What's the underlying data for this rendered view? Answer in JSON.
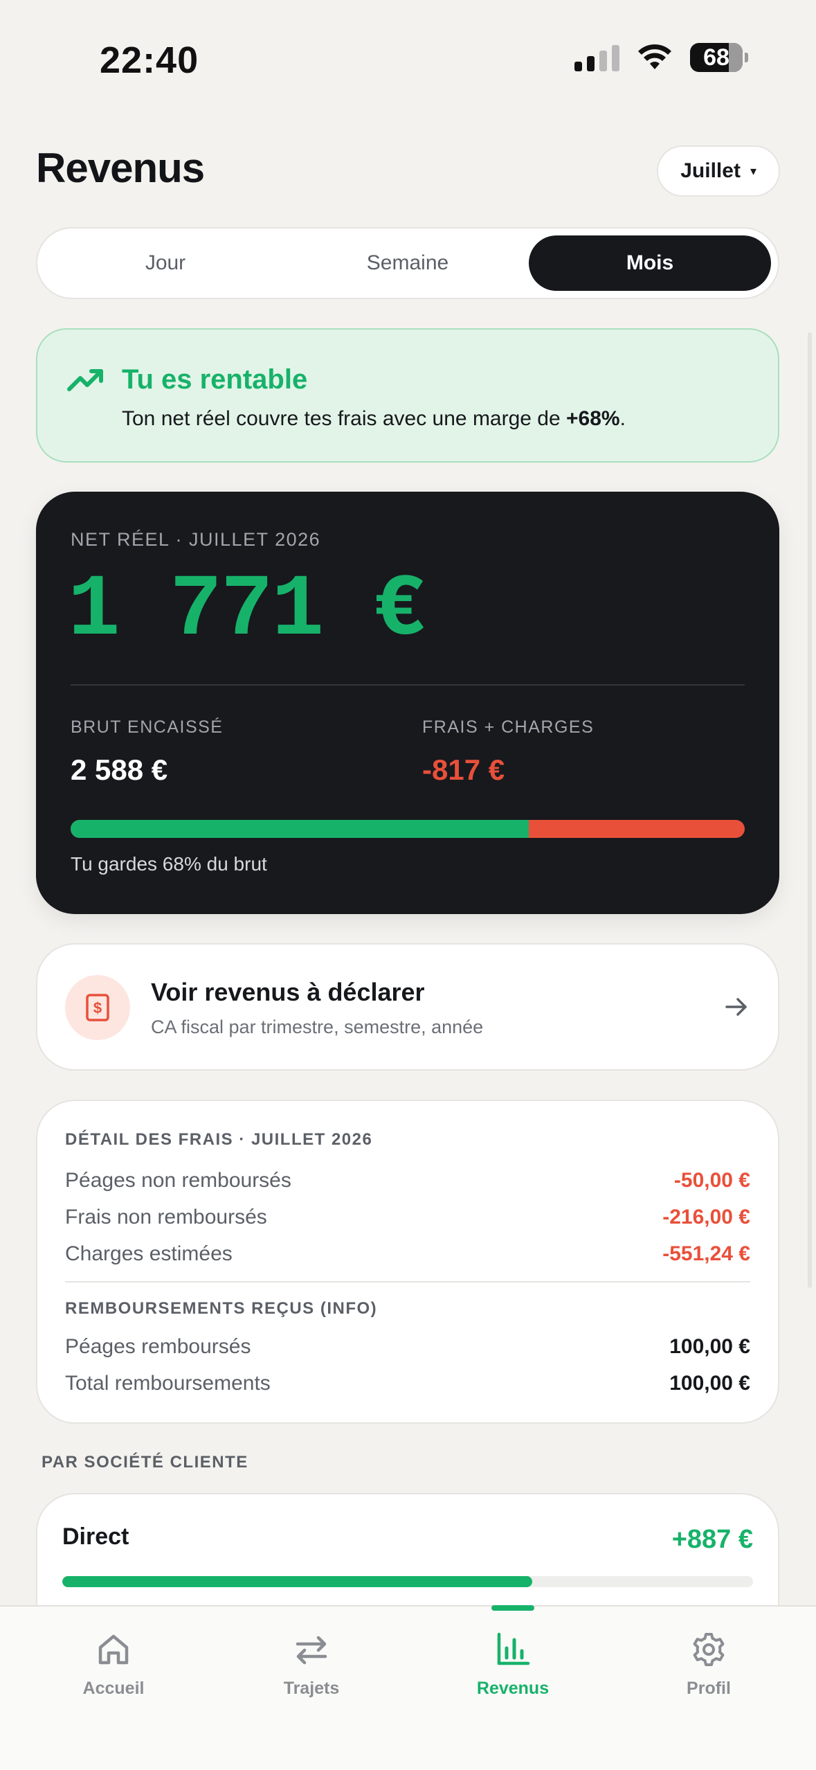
{
  "status_bar": {
    "time": "22:40",
    "battery": "68"
  },
  "header": {
    "title": "Revenus",
    "month_selector": "Juillet",
    "caret": "▾"
  },
  "segments": [
    {
      "label": "Jour",
      "active": false
    },
    {
      "label": "Semaine",
      "active": false
    },
    {
      "label": "Mois",
      "active": true
    }
  ],
  "profit_banner": {
    "title": "Tu es rentable",
    "text_prefix": "Ton net réel couvre tes frais avec une marge de ",
    "margin": "+68%",
    "text_suffix": "."
  },
  "net_card": {
    "label": "NET RÉEL · JUILLET 2026",
    "amount": "1 771 €",
    "brut_label": "BRUT ENCAISSÉ",
    "brut_value": "2 588 €",
    "frais_label": "FRAIS + CHARGES",
    "frais_value": "-817 €",
    "keep_percent": 68,
    "keep_text": "Tu gardes 68% du brut"
  },
  "declare_card": {
    "title": "Voir revenus à déclarer",
    "subtitle": "CA fiscal par trimestre, semestre, année"
  },
  "detail_card": {
    "title": "DÉTAIL DES FRAIS · JUILLET 2026",
    "expenses": [
      {
        "label": "Péages non remboursés",
        "value": "-50,00 €"
      },
      {
        "label": "Frais non remboursés",
        "value": "-216,00 €"
      },
      {
        "label": "Charges estimées",
        "value": "-551,24 €"
      }
    ],
    "reimb_title": "REMBOURSEMENTS REÇUS (INFO)",
    "reimbursements": [
      {
        "label": "Péages remboursés",
        "value": "100,00 €"
      },
      {
        "label": "Total remboursements",
        "value": "100,00 €"
      }
    ]
  },
  "clients": {
    "title": "PAR SOCIÉTÉ CLIENTE",
    "items": [
      {
        "name": "Direct",
        "amount": "+887 €",
        "share_percent": 68
      }
    ]
  },
  "tab_bar": {
    "tabs": [
      {
        "label": "Accueil",
        "icon": "home-icon",
        "active": false
      },
      {
        "label": "Trajets",
        "icon": "swap-arrows-icon",
        "active": false
      },
      {
        "label": "Revenus",
        "icon": "bar-chart-icon",
        "active": true
      },
      {
        "label": "Profil",
        "icon": "gear-icon",
        "active": false
      }
    ]
  },
  "colors": {
    "accent_green": "#17b26a",
    "accent_red": "#e9503a",
    "dark_card": "#17191d",
    "background": "#f3f2ef"
  }
}
